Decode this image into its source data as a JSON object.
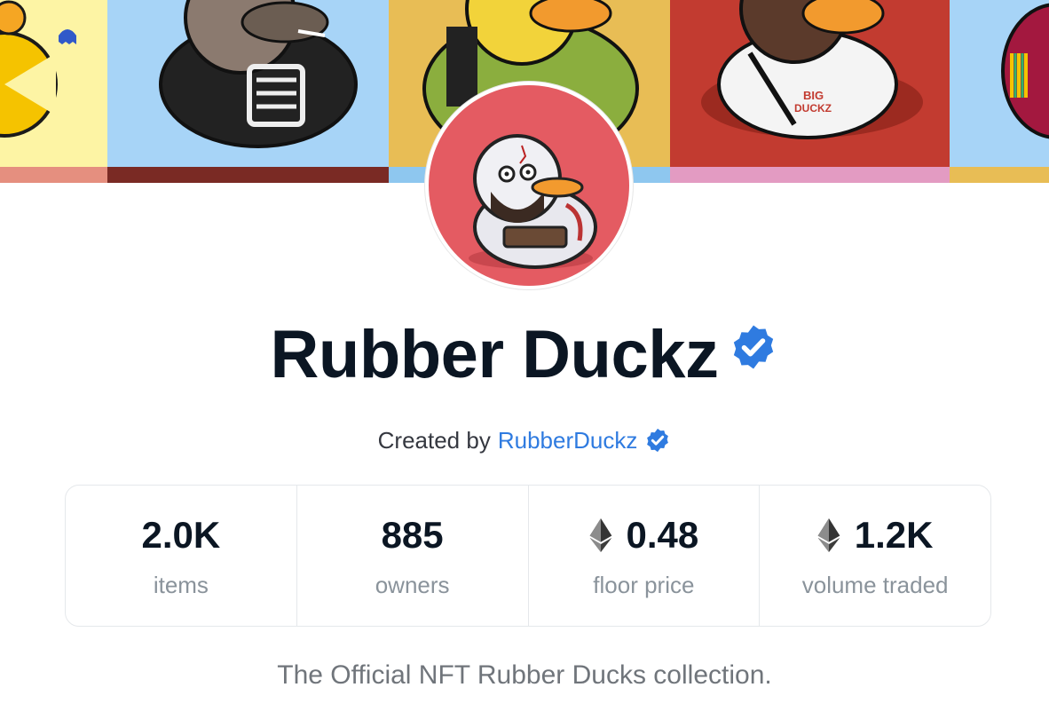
{
  "collection": {
    "name": "Rubber Duckz",
    "verified": true,
    "creator_prefix": "Created by",
    "creator_name": "RubberDuckz",
    "creator_verified": true,
    "description": "The Official NFT Rubber Ducks collection."
  },
  "stats": [
    {
      "value": "2.0K",
      "label": "items",
      "icon": null
    },
    {
      "value": "885",
      "label": "owners",
      "icon": null
    },
    {
      "value": "0.48",
      "label": "floor price",
      "icon": "ethereum-icon"
    },
    {
      "value": "1.2K",
      "label": "volume traded",
      "icon": "ethereum-icon"
    }
  ],
  "colors": {
    "accent": "#2f7be0",
    "verified_badge": "#2f7be0",
    "title_text": "#0b1623",
    "muted_text": "#8a939b",
    "avatar_bg": "#e45b62"
  },
  "banner": {
    "panels": [
      {
        "bg": "#fdf4a4",
        "strip": "#e58f7f",
        "subject": "pacman-duck"
      },
      {
        "bg": "#a7d4f7",
        "strip": "#7a2a24",
        "subject": "skeleton-shirt-duck"
      },
      {
        "bg": "#e8bd55",
        "strip": "#8ec7ef",
        "subject": "army-jacket-duck"
      },
      {
        "bg": "#c23b30",
        "strip": "#e39bc2",
        "subject": "baseball-jersey-duck"
      },
      {
        "bg": "#a7d4f7",
        "strip": "#e8bd55",
        "subject": "striped-duck"
      }
    ]
  }
}
